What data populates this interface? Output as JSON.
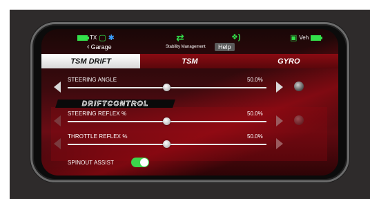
{
  "status_bar": {
    "tx_label": "TX",
    "veh_label": "Veh",
    "back_label": "Garage",
    "stability_label": "Stability Management",
    "help_label": "Help"
  },
  "tabs": [
    {
      "label": "TSM DRIFT",
      "active": true
    },
    {
      "label": "TSM",
      "active": false
    },
    {
      "label": "GYRO",
      "active": false
    }
  ],
  "steering_angle": {
    "label": "STEERING ANGLE",
    "value": "50.0%",
    "level": 0.5
  },
  "drift_control": {
    "title": "DRIFTCONTROL"
  },
  "steering_reflex": {
    "label": "STEERING REFLEX %",
    "value": "50.0%",
    "level": 0.5
  },
  "throttle_reflex": {
    "label": "THROTTLE REFLEX %",
    "value": "50.0%",
    "level": 0.5
  },
  "spinout_assist": {
    "label": "SPINOUT ASSIST",
    "enabled": true
  },
  "colors": {
    "accent_green": "#33e04a",
    "accent_red": "#b00d17",
    "bluetooth_blue": "#3aa0ff"
  },
  "icons": [
    "battery-icon",
    "antenna-icon",
    "bluetooth-icon",
    "swap-arrows-icon",
    "signal-icon",
    "vehicle-icon",
    "chevron-left-icon",
    "arrow-left-icon",
    "arrow-right-icon",
    "knob-icon"
  ]
}
